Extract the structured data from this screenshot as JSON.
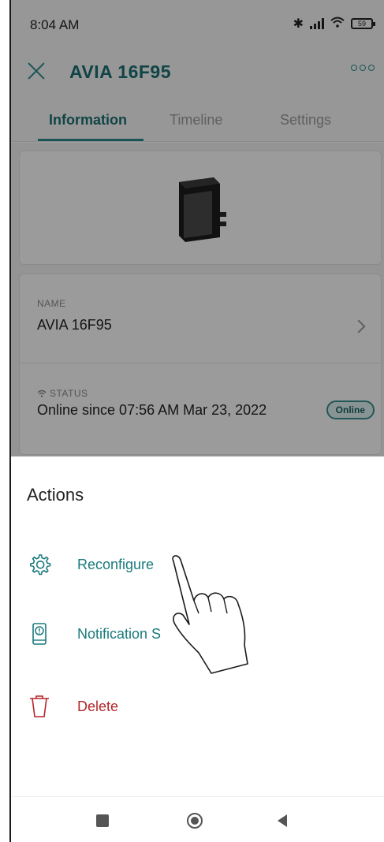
{
  "status_bar": {
    "time": "8:04 AM",
    "battery": "59"
  },
  "header": {
    "title": "AVIA 16F95"
  },
  "tabs": [
    {
      "label": "Information",
      "active": true
    },
    {
      "label": "Timeline",
      "active": false
    },
    {
      "label": "Settings",
      "active": false
    }
  ],
  "info": {
    "name_label": "NAME",
    "name_value": "AVIA 16F95",
    "status_label": "STATUS",
    "status_value": "Online since 07:56 AM Mar 23, 2022",
    "status_badge": "Online"
  },
  "actions_sheet": {
    "title": "Actions",
    "items": [
      {
        "label": "Reconfigure",
        "icon": "gear-icon",
        "color": "#1a7a7c"
      },
      {
        "label": "Notification S",
        "icon": "phone-notification-icon",
        "color": "#1a7a7c"
      },
      {
        "label": "Delete",
        "icon": "trash-icon",
        "color": "#b3262a"
      }
    ]
  },
  "colors": {
    "accent": "#1a7a7c",
    "danger": "#b3262a"
  }
}
